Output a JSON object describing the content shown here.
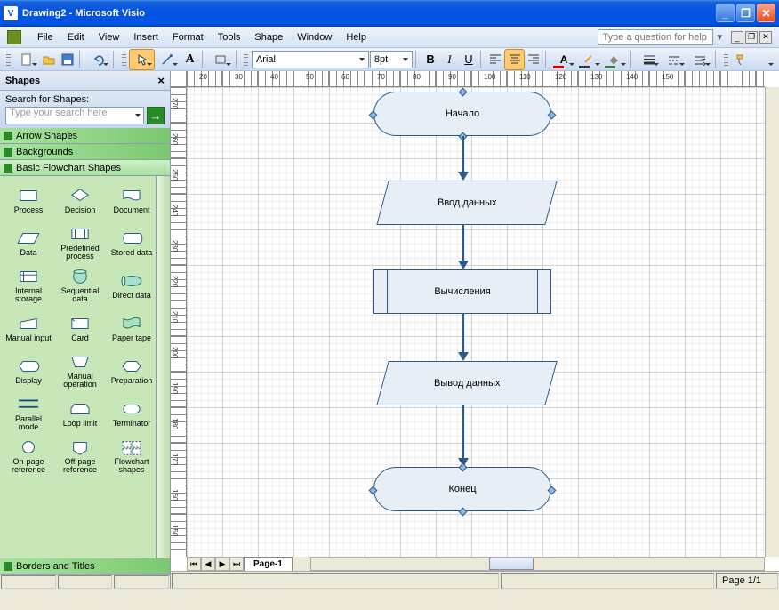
{
  "window": {
    "title": "Drawing2 - Microsoft Visio"
  },
  "menu": {
    "file": "File",
    "edit": "Edit",
    "view": "View",
    "insert": "Insert",
    "format": "Format",
    "tools": "Tools",
    "shape": "Shape",
    "window": "Window",
    "help": "Help"
  },
  "helpbox": {
    "placeholder": "Type a question for help"
  },
  "font": {
    "name": "Arial",
    "size": "8pt"
  },
  "shapes": {
    "title": "Shapes",
    "search_label": "Search for Shapes:",
    "search_placeholder": "Type your search here",
    "stencils": {
      "arrow": "Arrow Shapes",
      "backgrounds": "Backgrounds",
      "flowchart": "Basic Flowchart Shapes",
      "borders": "Borders and Titles"
    },
    "items": [
      {
        "label": "Process"
      },
      {
        "label": "Decision"
      },
      {
        "label": "Document"
      },
      {
        "label": "Data"
      },
      {
        "label": "Predefined process"
      },
      {
        "label": "Stored data"
      },
      {
        "label": "Internal storage"
      },
      {
        "label": "Sequential data"
      },
      {
        "label": "Direct data"
      },
      {
        "label": "Manual input"
      },
      {
        "label": "Card"
      },
      {
        "label": "Paper tape"
      },
      {
        "label": "Display"
      },
      {
        "label": "Manual operation"
      },
      {
        "label": "Preparation"
      },
      {
        "label": "Parallel mode"
      },
      {
        "label": "Loop limit"
      },
      {
        "label": "Terminator"
      },
      {
        "label": "On-page reference"
      },
      {
        "label": "Off-page reference"
      },
      {
        "label": "Flowchart shapes"
      }
    ]
  },
  "flowchart": {
    "n1": "Начало",
    "n2": "Ввод данных",
    "n3": "Вычисления",
    "n4": "Вывод данных",
    "n5": "Конец"
  },
  "tabs": {
    "page1": "Page-1"
  },
  "status": {
    "page": "Page 1/1"
  },
  "ruler_h": [
    "20",
    "30",
    "40",
    "50",
    "60",
    "70",
    "80",
    "90",
    "100",
    "110",
    "120",
    "130",
    "140",
    "150"
  ],
  "ruler_v": [
    "270",
    "260",
    "250",
    "240",
    "230",
    "220",
    "210",
    "200",
    "190",
    "180",
    "170",
    "160",
    "150"
  ]
}
